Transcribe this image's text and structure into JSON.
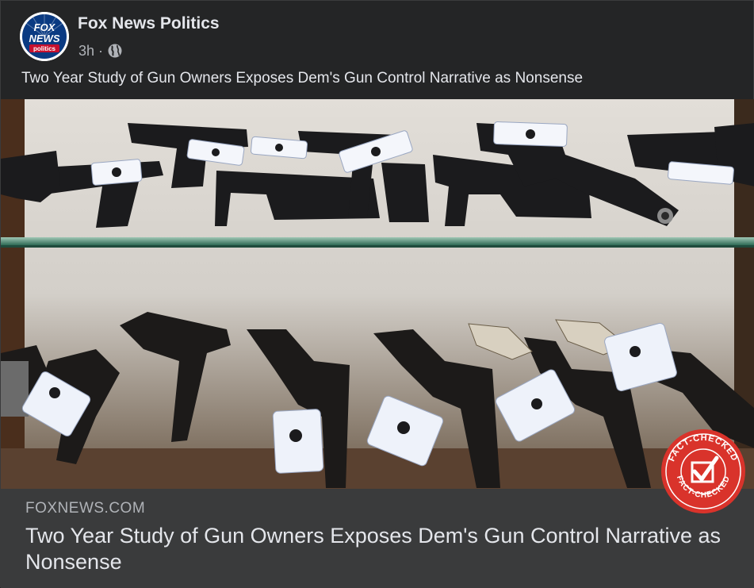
{
  "page": {
    "name": "Fox News Politics",
    "time": "3h",
    "separator": "·",
    "privacy_icon": "globe-icon"
  },
  "logo": {
    "line1": "FOX",
    "line2": "NEWS",
    "line3": "politics"
  },
  "post": {
    "caption": "Two Year Study of Gun Owners Exposes Dem's Gun Control Narrative as Nonsense"
  },
  "link_preview": {
    "domain": "FOXNEWS.COM",
    "title": "Two Year Study of Gun Owners Exposes Dem's Gun Control Narrative as Nonsense"
  },
  "badge": {
    "top_text": "FACT-CHECKED",
    "bottom_text": "FACT-CHECKED",
    "color": "#d9332b"
  },
  "colors": {
    "background": "#242526",
    "link_preview_bg": "#3a3b3c",
    "primary_text": "#e4e6eb",
    "secondary_text": "#b0b3b8",
    "fox_blue": "#0a3a82",
    "fox_red": "#c8102e"
  }
}
